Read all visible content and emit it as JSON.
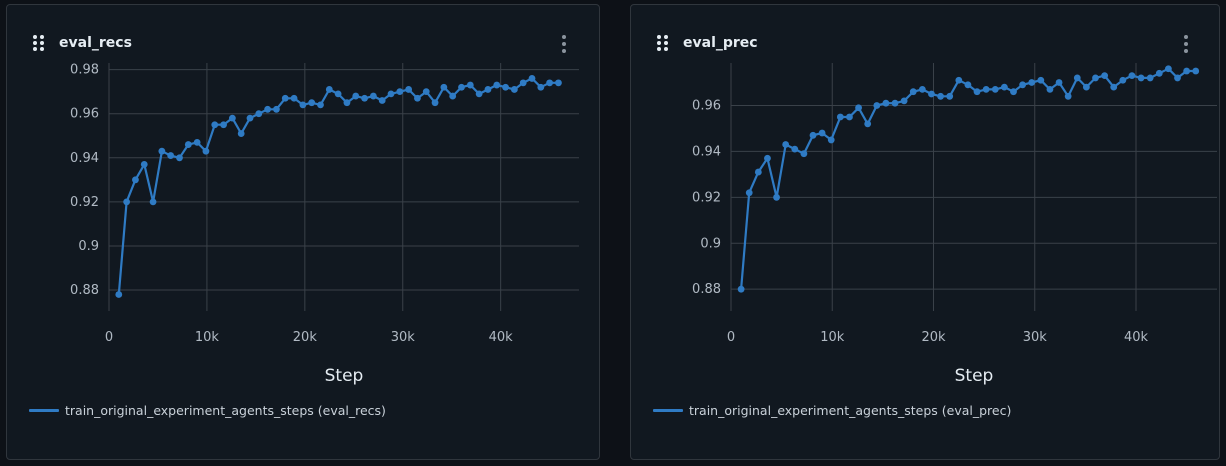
{
  "colors": {
    "series": "#2f7bc4",
    "grid": "#3a4149",
    "tick": "#b1bac4"
  },
  "icons": {
    "drag": "drag-handle-icon",
    "menu": "more-vertical-icon"
  },
  "panels": [
    {
      "title": "eval_recs",
      "legend": "train_original_experiment_agents_steps (eval_recs)"
    },
    {
      "title": "eval_prec",
      "legend": "train_original_experiment_agents_steps (eval_prec)"
    }
  ],
  "chart_data": [
    {
      "type": "line",
      "title": "eval_recs",
      "xlabel": "Step",
      "ylabel": "",
      "xlim": [
        0,
        48000
      ],
      "ylim": [
        0.8705,
        0.983
      ],
      "xticks": [
        0,
        10000,
        20000,
        30000,
        40000
      ],
      "xtick_labels": [
        "0",
        "10k",
        "20k",
        "30k",
        "40k"
      ],
      "yticks": [
        0.88,
        0.9,
        0.92,
        0.94,
        0.96,
        0.98
      ],
      "ytick_labels": [
        "0.88",
        "0.9",
        "0.92",
        "0.94",
        "0.96",
        "0.98"
      ],
      "grid": true,
      "legend_position": "bottom-left",
      "series": [
        {
          "name": "train_original_experiment_agents_steps (eval_recs)",
          "x": [
            1000,
            1800,
            2700,
            3600,
            4500,
            5400,
            6300,
            7200,
            8100,
            9000,
            9900,
            10800,
            11700,
            12600,
            13500,
            14400,
            15300,
            16200,
            17100,
            18000,
            18900,
            19800,
            20700,
            21600,
            22500,
            23400,
            24300,
            25200,
            26100,
            27000,
            27900,
            28800,
            29700,
            30600,
            31500,
            32400,
            33300,
            34200,
            35100,
            36000,
            36900,
            37800,
            38700,
            39600,
            40500,
            41400,
            42300,
            43200,
            44100,
            45000,
            45900
          ],
          "y": [
            0.878,
            0.92,
            0.93,
            0.937,
            0.92,
            0.943,
            0.941,
            0.94,
            0.946,
            0.947,
            0.943,
            0.955,
            0.955,
            0.958,
            0.951,
            0.958,
            0.96,
            0.962,
            0.962,
            0.967,
            0.967,
            0.964,
            0.965,
            0.964,
            0.971,
            0.969,
            0.965,
            0.968,
            0.967,
            0.968,
            0.966,
            0.969,
            0.97,
            0.971,
            0.967,
            0.97,
            0.965,
            0.972,
            0.968,
            0.972,
            0.973,
            0.969,
            0.971,
            0.973,
            0.972,
            0.971,
            0.974,
            0.976,
            0.972,
            0.974,
            0.974
          ]
        }
      ]
    },
    {
      "type": "line",
      "title": "eval_prec",
      "xlabel": "Step",
      "ylabel": "",
      "xlim": [
        0,
        48000
      ],
      "ylim": [
        0.8705,
        0.9785
      ],
      "xticks": [
        0,
        10000,
        20000,
        30000,
        40000
      ],
      "xtick_labels": [
        "0",
        "10k",
        "20k",
        "30k",
        "40k"
      ],
      "yticks": [
        0.88,
        0.9,
        0.92,
        0.94,
        0.96
      ],
      "ytick_labels": [
        "0.88",
        "0.9",
        "0.92",
        "0.94",
        "0.96"
      ],
      "grid": true,
      "legend_position": "bottom-left",
      "series": [
        {
          "name": "train_original_experiment_agents_steps (eval_prec)",
          "x": [
            1000,
            1800,
            2700,
            3600,
            4500,
            5400,
            6300,
            7200,
            8100,
            9000,
            9900,
            10800,
            11700,
            12600,
            13500,
            14400,
            15300,
            16200,
            17100,
            18000,
            18900,
            19800,
            20700,
            21600,
            22500,
            23400,
            24300,
            25200,
            26100,
            27000,
            27900,
            28800,
            29700,
            30600,
            31500,
            32400,
            33300,
            34200,
            35100,
            36000,
            36900,
            37800,
            38700,
            39600,
            40500,
            41400,
            42300,
            43200,
            44100,
            45000,
            45900
          ],
          "y": [
            0.88,
            0.922,
            0.931,
            0.937,
            0.92,
            0.943,
            0.941,
            0.939,
            0.947,
            0.948,
            0.945,
            0.955,
            0.955,
            0.959,
            0.952,
            0.96,
            0.961,
            0.961,
            0.962,
            0.966,
            0.967,
            0.965,
            0.964,
            0.964,
            0.971,
            0.969,
            0.966,
            0.967,
            0.967,
            0.968,
            0.966,
            0.969,
            0.97,
            0.971,
            0.967,
            0.97,
            0.964,
            0.972,
            0.968,
            0.972,
            0.973,
            0.968,
            0.971,
            0.973,
            0.972,
            0.972,
            0.974,
            0.976,
            0.972,
            0.975,
            0.975
          ]
        }
      ]
    }
  ]
}
